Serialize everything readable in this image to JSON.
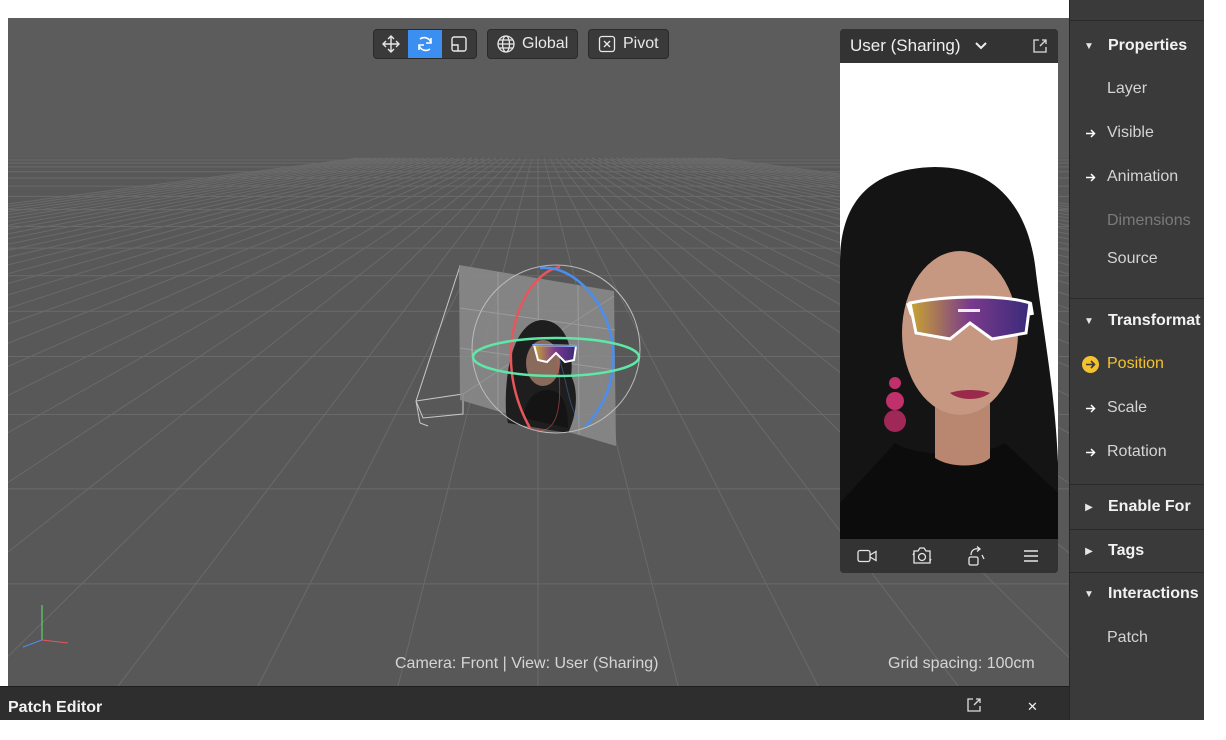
{
  "toolbar": {
    "tools": [
      "move-tool",
      "rotate-tool",
      "scale-tool"
    ],
    "space_label": "Global",
    "pivot_label": "Pivot"
  },
  "preview": {
    "title": "User (Sharing)",
    "footer_icons": [
      "video-camera-icon",
      "camera-flip-icon",
      "rotate-device-icon",
      "menu-icon"
    ]
  },
  "viewport": {
    "camera_info": "Camera: Front | View: User (Sharing)",
    "grid_spacing": "Grid spacing: 100cm"
  },
  "patch_editor": {
    "title": "Patch Editor"
  },
  "panel": {
    "properties": {
      "header": "Properties",
      "items": [
        "Layer",
        "Visible",
        "Animation",
        "Dimensions",
        "Source"
      ]
    },
    "transformations": {
      "header": "Transformat",
      "items": [
        "Position",
        "Scale",
        "Rotation"
      ]
    },
    "enable_for": {
      "header": "Enable For"
    },
    "tags": {
      "header": "Tags"
    },
    "interactions": {
      "header": "Interactions",
      "items": [
        "Patch"
      ]
    }
  },
  "colors": {
    "accent_blue": "#3b8ff0",
    "highlight_yellow": "#f4c22e",
    "viewport_bg": "#585858",
    "panel_bg": "#3a3a3a",
    "gizmo_red": "#e8555a",
    "gizmo_blue": "#4a8ff0",
    "gizmo_green": "#5ee8a8"
  }
}
